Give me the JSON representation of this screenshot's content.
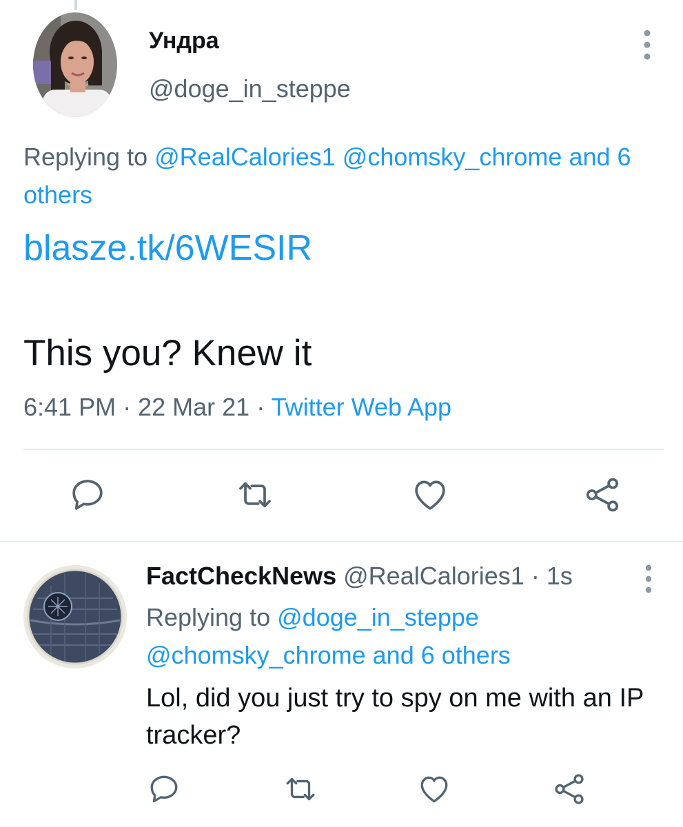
{
  "main_tweet": {
    "display_name": "Ундра",
    "handle": "@doge_in_steppe",
    "replying_prefix": "Replying to",
    "replying_mentions": [
      "@RealCalories1",
      "@chomsky_chrome"
    ],
    "replying_others": "and 6 others",
    "link": "blasze.tk/6WESIR",
    "text": "This you? Knew it",
    "time": "6:41 PM",
    "separator": "·",
    "date": "22 Mar 21",
    "source": "Twitter Web App",
    "actions": {
      "reply_icon": "comment-bubble-icon",
      "retweet_icon": "retweet-icon",
      "like_icon": "heart-icon",
      "share_icon": "share-icon"
    }
  },
  "reply_tweet": {
    "display_name": "FactCheckNews",
    "handle": "@RealCalories1",
    "separator": "·",
    "age": "1s",
    "replying_prefix": "Replying to",
    "replying_mentions": [
      "@doge_in_steppe",
      "@chomsky_chrome"
    ],
    "replying_others": "and 6 others",
    "text": "Lol, did you just try to spy on me with an IP tracker?"
  },
  "colors": {
    "link_blue": "#1d9bf0",
    "secondary_text": "#536471",
    "primary_text": "#0f1419",
    "divider": "#e7ebed"
  }
}
